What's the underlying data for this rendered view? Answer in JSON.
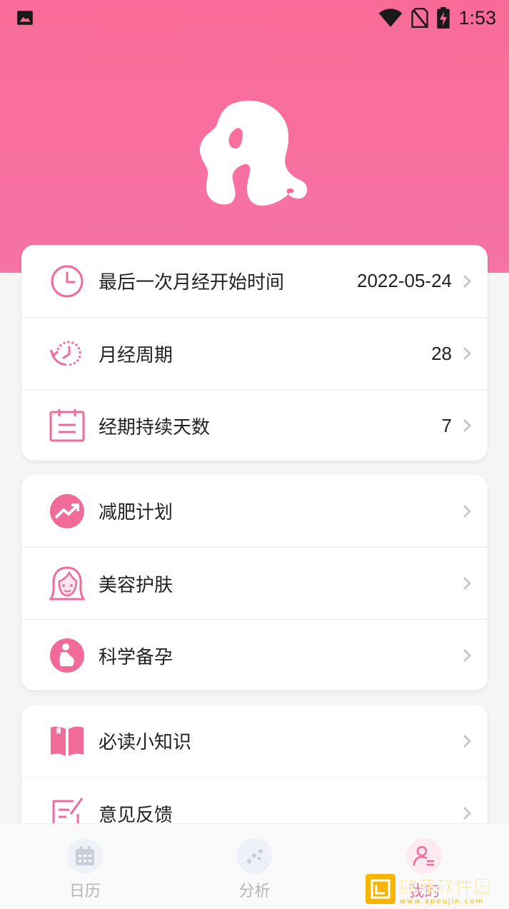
{
  "status_bar": {
    "time": "1:53"
  },
  "cycle_settings": [
    {
      "label": "最后一次月经开始时间",
      "value": "2022-05-24",
      "icon": "clock-icon"
    },
    {
      "label": "月经周期",
      "value": "28",
      "icon": "cycle-timer-icon"
    },
    {
      "label": "经期持续天数",
      "value": "7",
      "icon": "calendar-note-icon"
    }
  ],
  "features": [
    {
      "label": "减肥计划",
      "icon": "trend-up-icon"
    },
    {
      "label": "美容护肤",
      "icon": "woman-face-icon"
    },
    {
      "label": "科学备孕",
      "icon": "pregnancy-icon"
    }
  ],
  "more": [
    {
      "label": "必读小知识",
      "icon": "book-icon"
    },
    {
      "label": "意见反馈",
      "icon": "feedback-edit-icon"
    }
  ],
  "tabs": [
    {
      "label": "日历",
      "icon": "calendar-icon"
    },
    {
      "label": "分析",
      "icon": "analysis-icon"
    },
    {
      "label": "我的",
      "icon": "user-settings-icon"
    }
  ],
  "watermark": {
    "text": "欧菲软件园",
    "url": "www.apoujin.com"
  },
  "colors": {
    "accent": "#f06b98",
    "hero": "#f96b97"
  }
}
